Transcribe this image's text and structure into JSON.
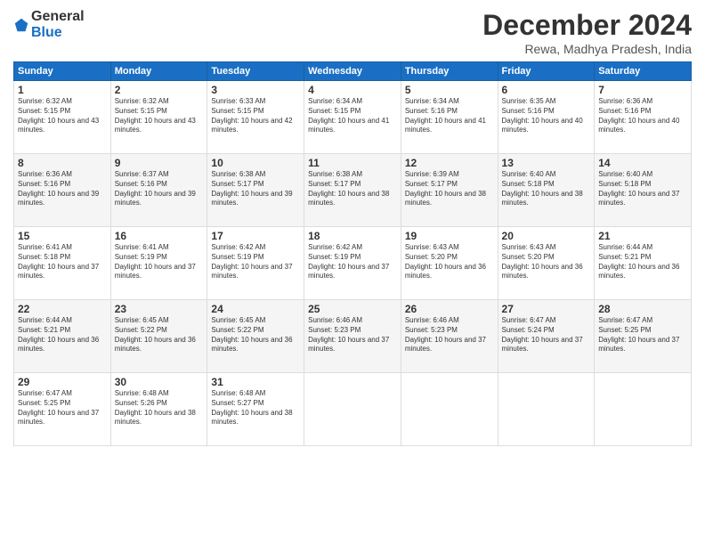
{
  "logo": {
    "general": "General",
    "blue": "Blue"
  },
  "title": "December 2024",
  "location": "Rewa, Madhya Pradesh, India",
  "days_of_week": [
    "Sunday",
    "Monday",
    "Tuesday",
    "Wednesday",
    "Thursday",
    "Friday",
    "Saturday"
  ],
  "weeks": [
    [
      {
        "day": "1",
        "sunrise": "6:32 AM",
        "sunset": "5:15 PM",
        "daylight": "10 hours and 43 minutes."
      },
      {
        "day": "2",
        "sunrise": "6:32 AM",
        "sunset": "5:15 PM",
        "daylight": "10 hours and 43 minutes."
      },
      {
        "day": "3",
        "sunrise": "6:33 AM",
        "sunset": "5:15 PM",
        "daylight": "10 hours and 42 minutes."
      },
      {
        "day": "4",
        "sunrise": "6:34 AM",
        "sunset": "5:15 PM",
        "daylight": "10 hours and 41 minutes."
      },
      {
        "day": "5",
        "sunrise": "6:34 AM",
        "sunset": "5:16 PM",
        "daylight": "10 hours and 41 minutes."
      },
      {
        "day": "6",
        "sunrise": "6:35 AM",
        "sunset": "5:16 PM",
        "daylight": "10 hours and 40 minutes."
      },
      {
        "day": "7",
        "sunrise": "6:36 AM",
        "sunset": "5:16 PM",
        "daylight": "10 hours and 40 minutes."
      }
    ],
    [
      {
        "day": "8",
        "sunrise": "6:36 AM",
        "sunset": "5:16 PM",
        "daylight": "10 hours and 39 minutes."
      },
      {
        "day": "9",
        "sunrise": "6:37 AM",
        "sunset": "5:16 PM",
        "daylight": "10 hours and 39 minutes."
      },
      {
        "day": "10",
        "sunrise": "6:38 AM",
        "sunset": "5:17 PM",
        "daylight": "10 hours and 39 minutes."
      },
      {
        "day": "11",
        "sunrise": "6:38 AM",
        "sunset": "5:17 PM",
        "daylight": "10 hours and 38 minutes."
      },
      {
        "day": "12",
        "sunrise": "6:39 AM",
        "sunset": "5:17 PM",
        "daylight": "10 hours and 38 minutes."
      },
      {
        "day": "13",
        "sunrise": "6:40 AM",
        "sunset": "5:18 PM",
        "daylight": "10 hours and 38 minutes."
      },
      {
        "day": "14",
        "sunrise": "6:40 AM",
        "sunset": "5:18 PM",
        "daylight": "10 hours and 37 minutes."
      }
    ],
    [
      {
        "day": "15",
        "sunrise": "6:41 AM",
        "sunset": "5:18 PM",
        "daylight": "10 hours and 37 minutes."
      },
      {
        "day": "16",
        "sunrise": "6:41 AM",
        "sunset": "5:19 PM",
        "daylight": "10 hours and 37 minutes."
      },
      {
        "day": "17",
        "sunrise": "6:42 AM",
        "sunset": "5:19 PM",
        "daylight": "10 hours and 37 minutes."
      },
      {
        "day": "18",
        "sunrise": "6:42 AM",
        "sunset": "5:19 PM",
        "daylight": "10 hours and 37 minutes."
      },
      {
        "day": "19",
        "sunrise": "6:43 AM",
        "sunset": "5:20 PM",
        "daylight": "10 hours and 36 minutes."
      },
      {
        "day": "20",
        "sunrise": "6:43 AM",
        "sunset": "5:20 PM",
        "daylight": "10 hours and 36 minutes."
      },
      {
        "day": "21",
        "sunrise": "6:44 AM",
        "sunset": "5:21 PM",
        "daylight": "10 hours and 36 minutes."
      }
    ],
    [
      {
        "day": "22",
        "sunrise": "6:44 AM",
        "sunset": "5:21 PM",
        "daylight": "10 hours and 36 minutes."
      },
      {
        "day": "23",
        "sunrise": "6:45 AM",
        "sunset": "5:22 PM",
        "daylight": "10 hours and 36 minutes."
      },
      {
        "day": "24",
        "sunrise": "6:45 AM",
        "sunset": "5:22 PM",
        "daylight": "10 hours and 36 minutes."
      },
      {
        "day": "25",
        "sunrise": "6:46 AM",
        "sunset": "5:23 PM",
        "daylight": "10 hours and 37 minutes."
      },
      {
        "day": "26",
        "sunrise": "6:46 AM",
        "sunset": "5:23 PM",
        "daylight": "10 hours and 37 minutes."
      },
      {
        "day": "27",
        "sunrise": "6:47 AM",
        "sunset": "5:24 PM",
        "daylight": "10 hours and 37 minutes."
      },
      {
        "day": "28",
        "sunrise": "6:47 AM",
        "sunset": "5:25 PM",
        "daylight": "10 hours and 37 minutes."
      }
    ],
    [
      {
        "day": "29",
        "sunrise": "6:47 AM",
        "sunset": "5:25 PM",
        "daylight": "10 hours and 37 minutes."
      },
      {
        "day": "30",
        "sunrise": "6:48 AM",
        "sunset": "5:26 PM",
        "daylight": "10 hours and 38 minutes."
      },
      {
        "day": "31",
        "sunrise": "6:48 AM",
        "sunset": "5:27 PM",
        "daylight": "10 hours and 38 minutes."
      },
      null,
      null,
      null,
      null
    ]
  ]
}
